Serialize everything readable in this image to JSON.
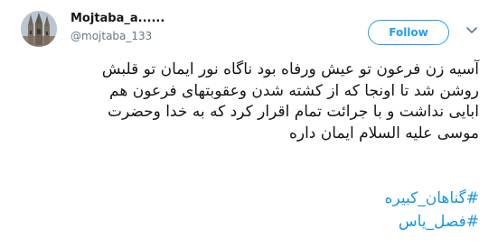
{
  "author": {
    "display_name": "Mojtaba_a......",
    "handle": "@mojtaba_133",
    "avatar_icon": "church-towers-photo"
  },
  "follow_button": {
    "label": "Follow",
    "color": "#1da1f2"
  },
  "menu_icon": "chevron-down-icon",
  "tweet": {
    "lines": [
      "آسیه زن فرعون تو عیش ورفاه بود ناگاه نور ایمان تو قلبش",
      "روشن شد تا اونجا که از کشته شدن وعقوبتهای فرعون هم",
      "ابایی نداشت و با جرائت  تمام اقرار کرد که به خدا وحضرت",
      "موسی علیه السلام ایمان داره"
    ],
    "hashtags": [
      "#گناهان_کبیره",
      "#فصل_یاس"
    ],
    "link_color": "#1b95e0"
  }
}
